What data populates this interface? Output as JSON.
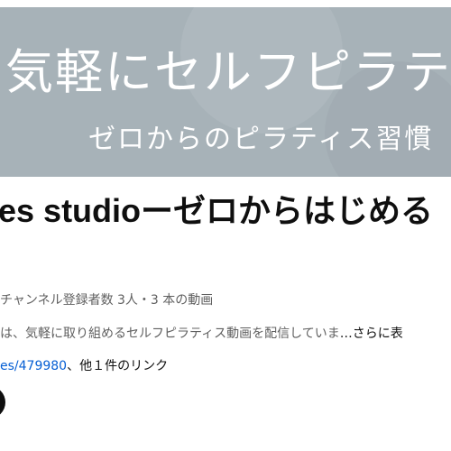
{
  "banner": {
    "title": "気軽にセルフピラティ",
    "subtitle": "ゼロからのピラティス習慣"
  },
  "channel": {
    "name": "es studioーゼロからはじめる",
    "meta": "チャンネル登録者数 3人・3 本の動画",
    "description": "は、気軽に取り組めるセルフピラティス動画を配信していま",
    "description_more": "…さらに表",
    "link_url": "es/479980",
    "link_suffix": "、他１件のリンク"
  },
  "colors": {
    "banner_bg": "#a7b2b8",
    "link": "#065fd4",
    "text_primary": "#0f0f0f",
    "text_secondary": "#606060"
  }
}
